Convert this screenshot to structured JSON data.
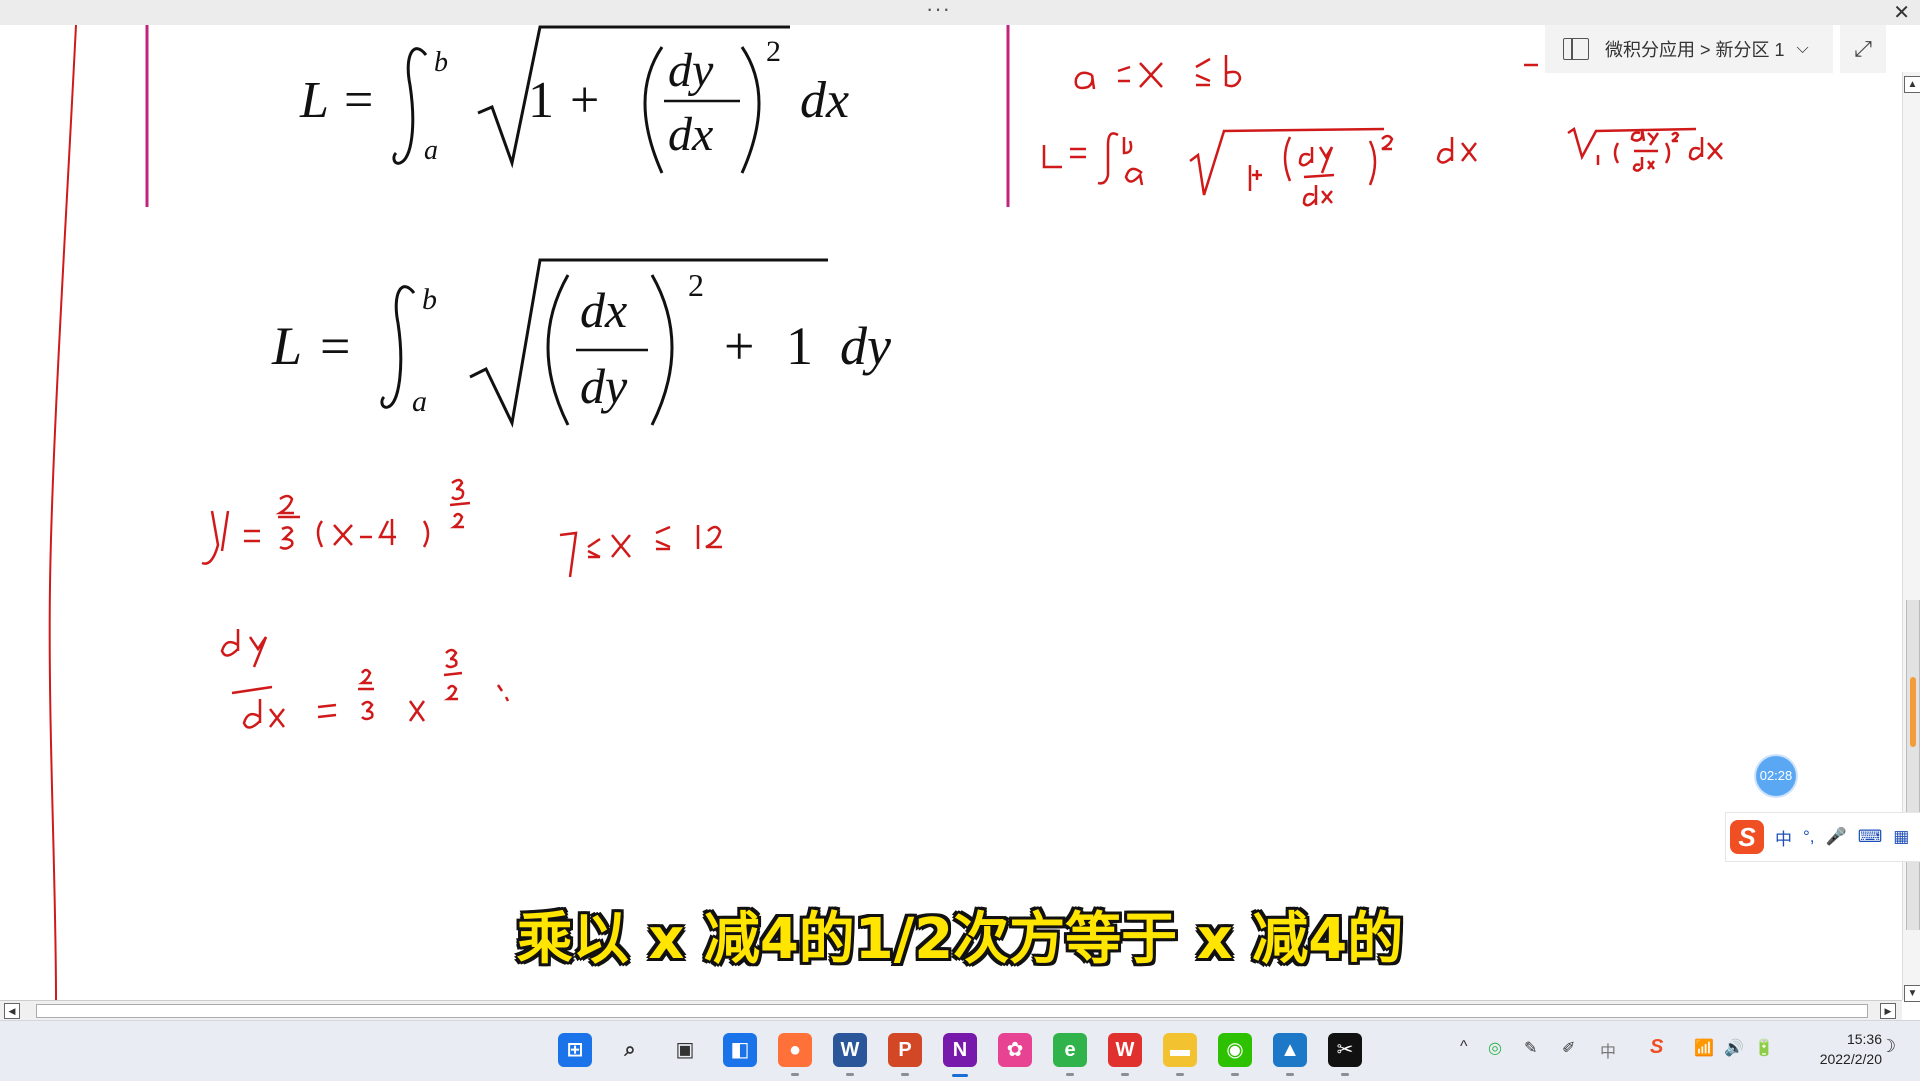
{
  "window": {
    "dots": "···",
    "close_glyph": "✕"
  },
  "breadcrumb": {
    "text": "微积分应用 > 新分区 1",
    "chevron": "⌵"
  },
  "expand_glyph": "⤢",
  "formulas": {
    "f1": {
      "L": "L",
      "eq": "=",
      "upper": "b",
      "lower": "a",
      "one": "1",
      "plus": "+",
      "num": "dy",
      "den": "dx",
      "exp": "2",
      "diff": "dx"
    },
    "f2": {
      "L": "L",
      "eq": "=",
      "upper": "b",
      "lower": "a",
      "num": "dx",
      "den": "dy",
      "exp": "2",
      "plus": "+",
      "one": "1",
      "diff": "dy"
    }
  },
  "timer": "02:28",
  "ime": {
    "logo": "S",
    "mode": "中",
    "punct": "°,",
    "mic": "🎤",
    "keyboard": "⌨",
    "menu": "▦"
  },
  "subtitle": "乘以 x 减4的1/2次方等于 x 减4的",
  "taskbar": {
    "apps": [
      {
        "name": "start",
        "glyph": "⊞",
        "color": "#1a73e8"
      },
      {
        "name": "search",
        "glyph": "⌕",
        "color": "#333333"
      },
      {
        "name": "task-view",
        "glyph": "▣",
        "color": "#333333"
      },
      {
        "name": "widgets",
        "glyph": "◧",
        "color": "#1a73e8"
      },
      {
        "name": "firefox",
        "glyph": "●",
        "color": "#ff7139"
      },
      {
        "name": "word",
        "glyph": "W",
        "color": "#2b579a"
      },
      {
        "name": "powerpoint",
        "glyph": "P",
        "color": "#d24726"
      },
      {
        "name": "onenote",
        "glyph": "N",
        "color": "#7719aa"
      },
      {
        "name": "app-colorful",
        "glyph": "✿",
        "color": "#e84393"
      },
      {
        "name": "browser-e",
        "glyph": "e",
        "color": "#2fb34a"
      },
      {
        "name": "wps",
        "glyph": "W",
        "color": "#e0312f"
      },
      {
        "name": "file-explorer",
        "glyph": "▬",
        "color": "#f2c230"
      },
      {
        "name": "wechat",
        "glyph": "◉",
        "color": "#2dc100"
      },
      {
        "name": "photos",
        "glyph": "▲",
        "color": "#1e78c8"
      },
      {
        "name": "capcut",
        "glyph": "✂",
        "color": "#111111"
      }
    ],
    "tray": {
      "chevron": "^",
      "lang": "中",
      "sogou": "S",
      "wifi": "📶",
      "volume": "🔊",
      "battery": "🔋",
      "moon": "☽"
    },
    "time": "15:36",
    "date": "2022/2/20"
  }
}
